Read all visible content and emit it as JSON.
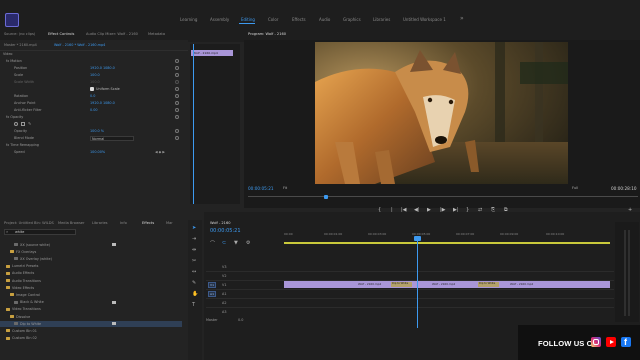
{
  "workspaces": [
    "Learning",
    "Assembly",
    "Editing",
    "Color",
    "Effects",
    "Audio",
    "Graphics",
    "Libraries",
    "Untitled Workspace 1"
  ],
  "active_workspace": "Editing",
  "source_tabs": [
    "Source: (no clips)",
    "Effect Controls",
    "Audio Clip Mixer: Wolf - 2160",
    "Metadata"
  ],
  "effect_controls": {
    "master": "Master * 2160.mp4",
    "clip": "Wolf - 2160 * Wolf - 2160.mp4",
    "timeline_clip": "Wolf - 2160.mp4",
    "rows": [
      {
        "label": "Video",
        "value": ""
      },
      {
        "label": "fx  Motion",
        "value": ""
      },
      {
        "label": "Position",
        "value": "1920.0    1080.0"
      },
      {
        "label": "Scale",
        "value": "100.0"
      },
      {
        "label": "Scale Width",
        "value": "100.0"
      },
      {
        "label": "",
        "value": "Uniform Scale"
      },
      {
        "label": "Rotation",
        "value": "0.0"
      },
      {
        "label": "Anchor Point",
        "value": "1920.0    1080.0"
      },
      {
        "label": "Anti-flicker Filter",
        "value": "0.00"
      },
      {
        "label": "fx  Opacity",
        "value": ""
      },
      {
        "label": "",
        "value": ""
      },
      {
        "label": "Opacity",
        "value": "100.0 %"
      },
      {
        "label": "Blend Mode",
        "value": "Normal"
      },
      {
        "label": "fx  Time Remapping",
        "value": ""
      },
      {
        "label": "Speed",
        "value": "100.00%"
      }
    ]
  },
  "program": {
    "title": "Program: Wolf - 2160",
    "timecode": "00:00:05:21",
    "fit": "Fit",
    "resolution": "Full",
    "duration": "00:00:28:10"
  },
  "transport": [
    "{",
    "|",
    "|◀",
    "◀|",
    "▶",
    "|▶",
    "▶|",
    "}",
    "⇄",
    "⎘",
    "⧉",
    "+"
  ],
  "project": {
    "tabs": [
      "Project: Untitled",
      "Bin: WILDS",
      "Media Browser",
      "Libraries",
      "Info",
      "Effects",
      "Mar"
    ],
    "search": "white",
    "tree": [
      {
        "label": "XX (source white)",
        "kind": "fx",
        "indent": 14,
        "badge": true
      },
      {
        "label": "FX Overlays",
        "kind": "bin",
        "indent": 10
      },
      {
        "label": "XX Overlay (white)",
        "kind": "fx",
        "indent": 14
      },
      {
        "label": "Lumetri Presets",
        "kind": "bin",
        "indent": 6
      },
      {
        "label": "Audio Effects",
        "kind": "bin",
        "indent": 6
      },
      {
        "label": "Audio Transitions",
        "kind": "bin",
        "indent": 6
      },
      {
        "label": "Video Effects",
        "kind": "bin",
        "indent": 6
      },
      {
        "label": "Image Control",
        "kind": "bin",
        "indent": 10
      },
      {
        "label": "Black & White",
        "kind": "fx",
        "indent": 14,
        "badge": true
      },
      {
        "label": "Video Transitions",
        "kind": "bin",
        "indent": 6
      },
      {
        "label": "Dissolve",
        "kind": "bin",
        "indent": 10
      },
      {
        "label": "Dip to White",
        "kind": "fx",
        "indent": 14,
        "badge": true,
        "selected": true
      },
      {
        "label": "Custom Bin 01",
        "kind": "bin",
        "indent": 6
      },
      {
        "label": "Custom Bin 02",
        "kind": "bin",
        "indent": 6
      }
    ]
  },
  "timeline": {
    "tab": "Wolf - 2160",
    "timecode": "00:00:05:21",
    "ruler": [
      "00:00",
      "00:00:01:00",
      "00:00:03:00",
      "00:00:05:00",
      "00:00:07:00",
      "00:00:09:00",
      "00:00:10:00"
    ],
    "tracks": [
      "V3",
      "V2",
      "V1",
      "A1",
      "A2",
      "A3"
    ],
    "mixer": "Master",
    "mixer_value": "0.0",
    "clip_labels": [
      "Wolf - 2160.mp4",
      "Wolf - 2160.mp4",
      "Wolf - 2160.mp4"
    ],
    "transition_labels": [
      "Dip to White",
      "Dip to White"
    ]
  },
  "social": {
    "label": "FOLLOW US ON",
    "colors": {
      "instagram": "#d6249f",
      "youtube": "#ff0000",
      "facebook": "#1877f2"
    }
  },
  "colors": {
    "accent": "#3d9af0",
    "clip": "#a996d8",
    "work_area": "#c9c93b"
  }
}
